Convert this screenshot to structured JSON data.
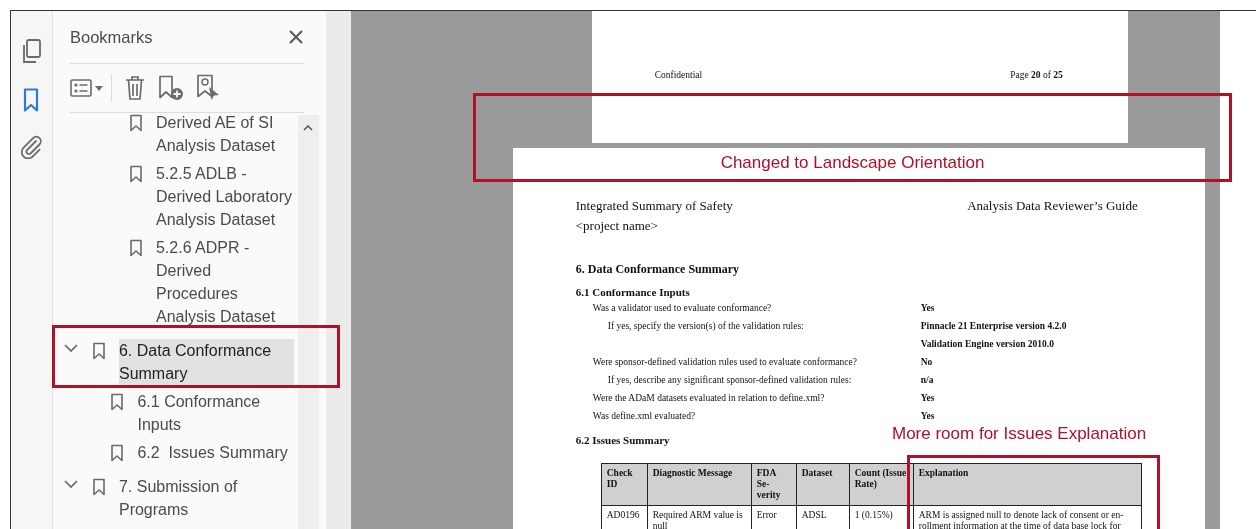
{
  "sidebar": {
    "title": "Bookmarks",
    "tree": [
      {
        "children": [
          {
            "children": [
              {
                "label": "Derived AE of SI Analysis Dataset",
                "selected": false
              },
              {
                "label": "5.2.5 ADLB - Derived Laboratory Analysis Dataset",
                "selected": false
              },
              {
                "label": "5.2.6 ADPR - Derived Procedures Analysis Dataset",
                "selected": false
              }
            ]
          }
        ]
      },
      {
        "label": "6. Data Conformance Summary",
        "selected": true,
        "expanded": true,
        "children": [
          {
            "label": "6.1 Conformance Inputs",
            "selected": false
          },
          {
            "label": "6.2  Issues Summary",
            "selected": false
          }
        ]
      },
      {
        "label": "7. Submission of Programs",
        "selected": false,
        "expanded": true
      }
    ]
  },
  "previous_page": {
    "footer_left": "Confidential",
    "footer_right": "Page **20** of **25**"
  },
  "page": {
    "header_left": "Integrated Summary of Safety",
    "header_right": "Analysis Data Reviewer’s Guide",
    "project": "<project name>",
    "heading": "6.  Data Conformance Summary",
    "inputs_heading": "6.1 Conformance Inputs",
    "questions": [
      {
        "text": "Was a validator used to evaluate conformance?",
        "answers": [
          "Yes"
        ],
        "children": [
          {
            "text": "If yes, specify the version(s) of the validation rules:",
            "answers": [
              "Pinnacle 21 Enterprise version 4.2.0",
              "Validation Engine version 2010.0"
            ]
          }
        ]
      },
      {
        "text": "Were sponsor-defined validation rules used to evaluate conformance?",
        "answers": [
          "No"
        ],
        "children": [
          {
            "text": "If yes, describe any significant sponsor-defined validation rules:",
            "answers": [
              "n/a"
            ]
          }
        ]
      },
      {
        "text": "Were the ADaM datasets evaluated in relation to define.xml?",
        "answers": [
          "Yes"
        ]
      },
      {
        "text": "Was define.xml evaluated?",
        "answers": [
          "Yes"
        ]
      }
    ],
    "issues_heading": "6.2  Issues Summary",
    "table": {
      "columns": [
        "Check ID",
        "Diagnostic Message",
        "FDA Se-verity",
        "Dataset",
        "Count (Issue Rate)",
        "Explanation"
      ],
      "rows": [
        [
          "AD0196",
          "Required ARM value is null",
          "Error",
          "ADSL",
          "1 (0.15%)",
          "ARM is assigned null to denote lack of consent or en-rollment information at the time of data base lock for"
        ]
      ]
    }
  },
  "annotations": [
    {
      "kind": "framed_label",
      "label": "Changed to Landscape Orientation"
    },
    {
      "kind": "frame"
    },
    {
      "kind": "label",
      "label": "More room for Issues Explanation"
    },
    {
      "kind": "frame"
    }
  ]
}
